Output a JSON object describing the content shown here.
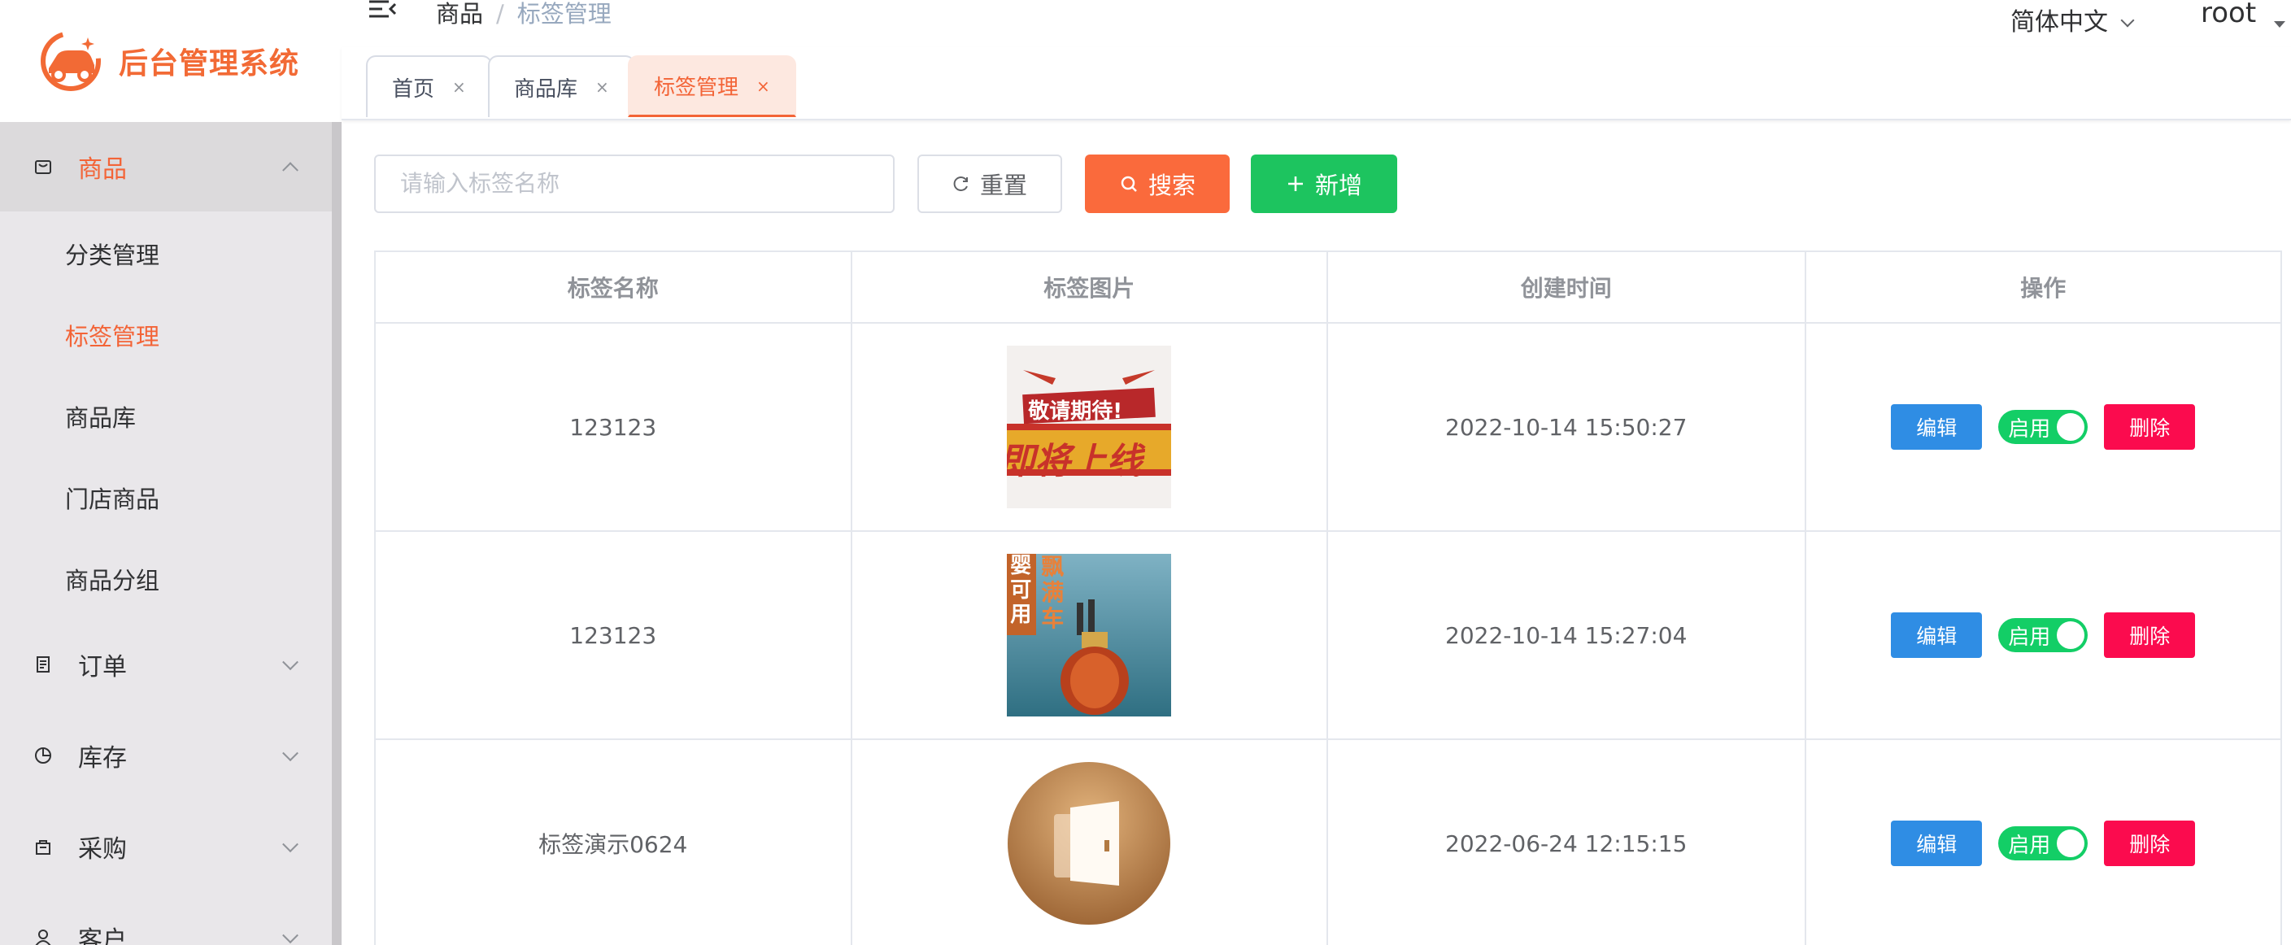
{
  "app": {
    "title": "后台管理系统"
  },
  "sidebar": {
    "groups": [
      {
        "label": "商品",
        "expanded": true
      },
      {
        "label": "订单"
      },
      {
        "label": "库存"
      },
      {
        "label": "采购"
      },
      {
        "label": "客户"
      }
    ],
    "sub_items": [
      {
        "label": "分类管理"
      },
      {
        "label": "标签管理",
        "active": true
      },
      {
        "label": "商品库"
      },
      {
        "label": "门店商品"
      },
      {
        "label": "商品分组"
      }
    ]
  },
  "header": {
    "breadcrumb": [
      "商品",
      "标签管理"
    ],
    "breadcrumb_sep": "/",
    "language": "简体中文",
    "user": "root"
  },
  "tags": [
    {
      "label": "首页",
      "close": "×"
    },
    {
      "label": "商品库",
      "close": "×"
    },
    {
      "label": "标签管理",
      "close": "×",
      "active": true
    }
  ],
  "toolbar": {
    "search_placeholder": "请输入标签名称",
    "reset_label": "重置",
    "search_label": "搜索",
    "add_label": "新增"
  },
  "table": {
    "columns": [
      "标签名称",
      "标签图片",
      "创建时间",
      "操作"
    ],
    "rows": [
      {
        "name": "123123",
        "image": "coming-soon-banner",
        "created": "2022-10-14 15:50:27",
        "edit": "编辑",
        "status": "启用",
        "delete": "删除",
        "img_text_a": "敬请期待!",
        "img_text_b": "即将上线"
      },
      {
        "name": "123123",
        "image": "car-perfume-bottle",
        "created": "2022-10-14 15:27:04",
        "edit": "编辑",
        "status": "启用",
        "delete": "删除",
        "img_text_a": "婴可用",
        "img_text_b": "飘满车"
      },
      {
        "name": "标签演示0624",
        "image": "door-icon-circle",
        "created": "2022-06-24 12:15:15",
        "edit": "编辑",
        "status": "启用",
        "delete": "删除"
      }
    ]
  },
  "colors": {
    "accent": "#f36437",
    "success": "#13ce66",
    "primary": "#2f8de4",
    "danger": "#fb0b4e"
  }
}
